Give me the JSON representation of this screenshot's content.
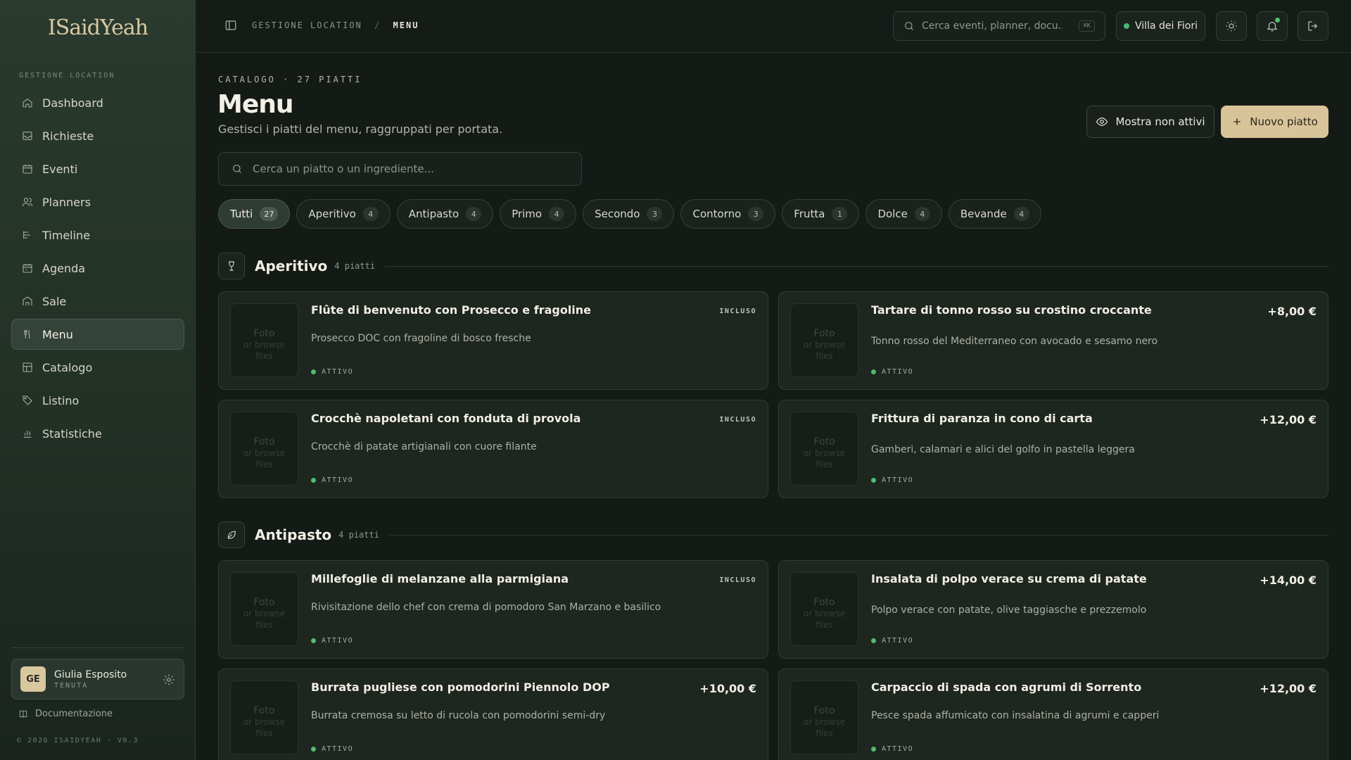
{
  "brand": {
    "logo_text": "ISaidYeah"
  },
  "sidebar": {
    "section_label": "GESTIONE LOCATION",
    "items": [
      {
        "label": "Dashboard",
        "icon": "home-icon"
      },
      {
        "label": "Richieste",
        "icon": "inbox-icon"
      },
      {
        "label": "Eventi",
        "icon": "calendar-icon"
      },
      {
        "label": "Planners",
        "icon": "users-icon"
      },
      {
        "label": "Timeline",
        "icon": "timeline-icon"
      },
      {
        "label": "Agenda",
        "icon": "agenda-icon"
      },
      {
        "label": "Sale",
        "icon": "building-icon"
      },
      {
        "label": "Menu",
        "icon": "utensils-icon"
      },
      {
        "label": "Catalogo",
        "icon": "grid-icon"
      },
      {
        "label": "Listino",
        "icon": "tag-icon"
      },
      {
        "label": "Statistiche",
        "icon": "chart-icon"
      }
    ],
    "active_item": "Menu",
    "user": {
      "initials": "GE",
      "name": "Giulia Esposito",
      "role": "TENUTA"
    },
    "docs_label": "Documentazione",
    "copyright": "© 2026 ISAIDYEAH · V0.3"
  },
  "topbar": {
    "breadcrumb": {
      "parent": "GESTIONE LOCATION",
      "separator": "/",
      "current": "MENU"
    },
    "search_placeholder": "Cerca eventi, planner, docu...",
    "search_shortcut": "⌘K",
    "venue": "Villa dei Fiori"
  },
  "header": {
    "overline": "CATALOGO · 27 PIATTI",
    "title": "Menu",
    "subtitle": "Gestisci i piatti del menu, raggruppati per portata.",
    "show_inactive_label": "Mostra non attivi",
    "new_dish_label": "Nuovo piatto",
    "search_placeholder": "Cerca un piatto o un ingrediente..."
  },
  "filters": [
    {
      "label": "Tutti",
      "count": "27",
      "active": true
    },
    {
      "label": "Aperitivo",
      "count": "4"
    },
    {
      "label": "Antipasto",
      "count": "4"
    },
    {
      "label": "Primo",
      "count": "4"
    },
    {
      "label": "Secondo",
      "count": "3"
    },
    {
      "label": "Contorno",
      "count": "3"
    },
    {
      "label": "Frutta",
      "count": "1"
    },
    {
      "label": "Dolce",
      "count": "4"
    },
    {
      "label": "Bevande",
      "count": "4"
    }
  ],
  "thumb_placeholder": {
    "title": "Foto",
    "line1": "or browse",
    "line2": "files"
  },
  "sections": [
    {
      "title": "Aperitivo",
      "count_label": "4 piatti",
      "dishes": [
        {
          "name": "Flûte di benvenuto con Prosecco e fragoline",
          "desc": "Prosecco DOC con fragoline di bosco fresche",
          "price": "INCLUSO",
          "status": "ATTIVO"
        },
        {
          "name": "Tartare di tonno rosso su crostino croccante",
          "desc": "Tonno rosso del Mediterraneo con avocado e sesamo nero",
          "price": "+8,00 €",
          "status": "ATTIVO"
        },
        {
          "name": "Crocchè napoletani con fonduta di provola",
          "desc": "Crocchè di patate artigianali con cuore filante",
          "price": "INCLUSO",
          "status": "ATTIVO"
        },
        {
          "name": "Frittura di paranza in cono di carta",
          "desc": "Gamberi, calamari e alici del golfo in pastella leggera",
          "price": "+12,00 €",
          "status": "ATTIVO"
        }
      ]
    },
    {
      "title": "Antipasto",
      "count_label": "4 piatti",
      "dishes": [
        {
          "name": "Millefoglie di melanzane alla parmigiana",
          "desc": "Rivisitazione dello chef con crema di pomodoro San Marzano e basilico",
          "price": "INCLUSO",
          "status": "ATTIVO"
        },
        {
          "name": "Insalata di polpo verace su crema di patate",
          "desc": "Polpo verace con patate, olive taggiasche e prezzemolo",
          "price": "+14,00 €",
          "status": "ATTIVO"
        },
        {
          "name": "Burrata pugliese con pomodorini Piennolo DOP",
          "desc": "Burrata cremosa su letto di rucola con pomodorini semi-dry",
          "price": "+10,00 €",
          "status": "ATTIVO"
        },
        {
          "name": "Carpaccio di spada con agrumi di Sorrento",
          "desc": "Pesce spada affumicato con insalatina di agrumi e capperi",
          "price": "+12,00 €",
          "status": "ATTIVO"
        }
      ]
    }
  ],
  "colors": {
    "accent": "#d9c49a",
    "active_dot": "#4ebd6c",
    "background": "#141a16"
  }
}
